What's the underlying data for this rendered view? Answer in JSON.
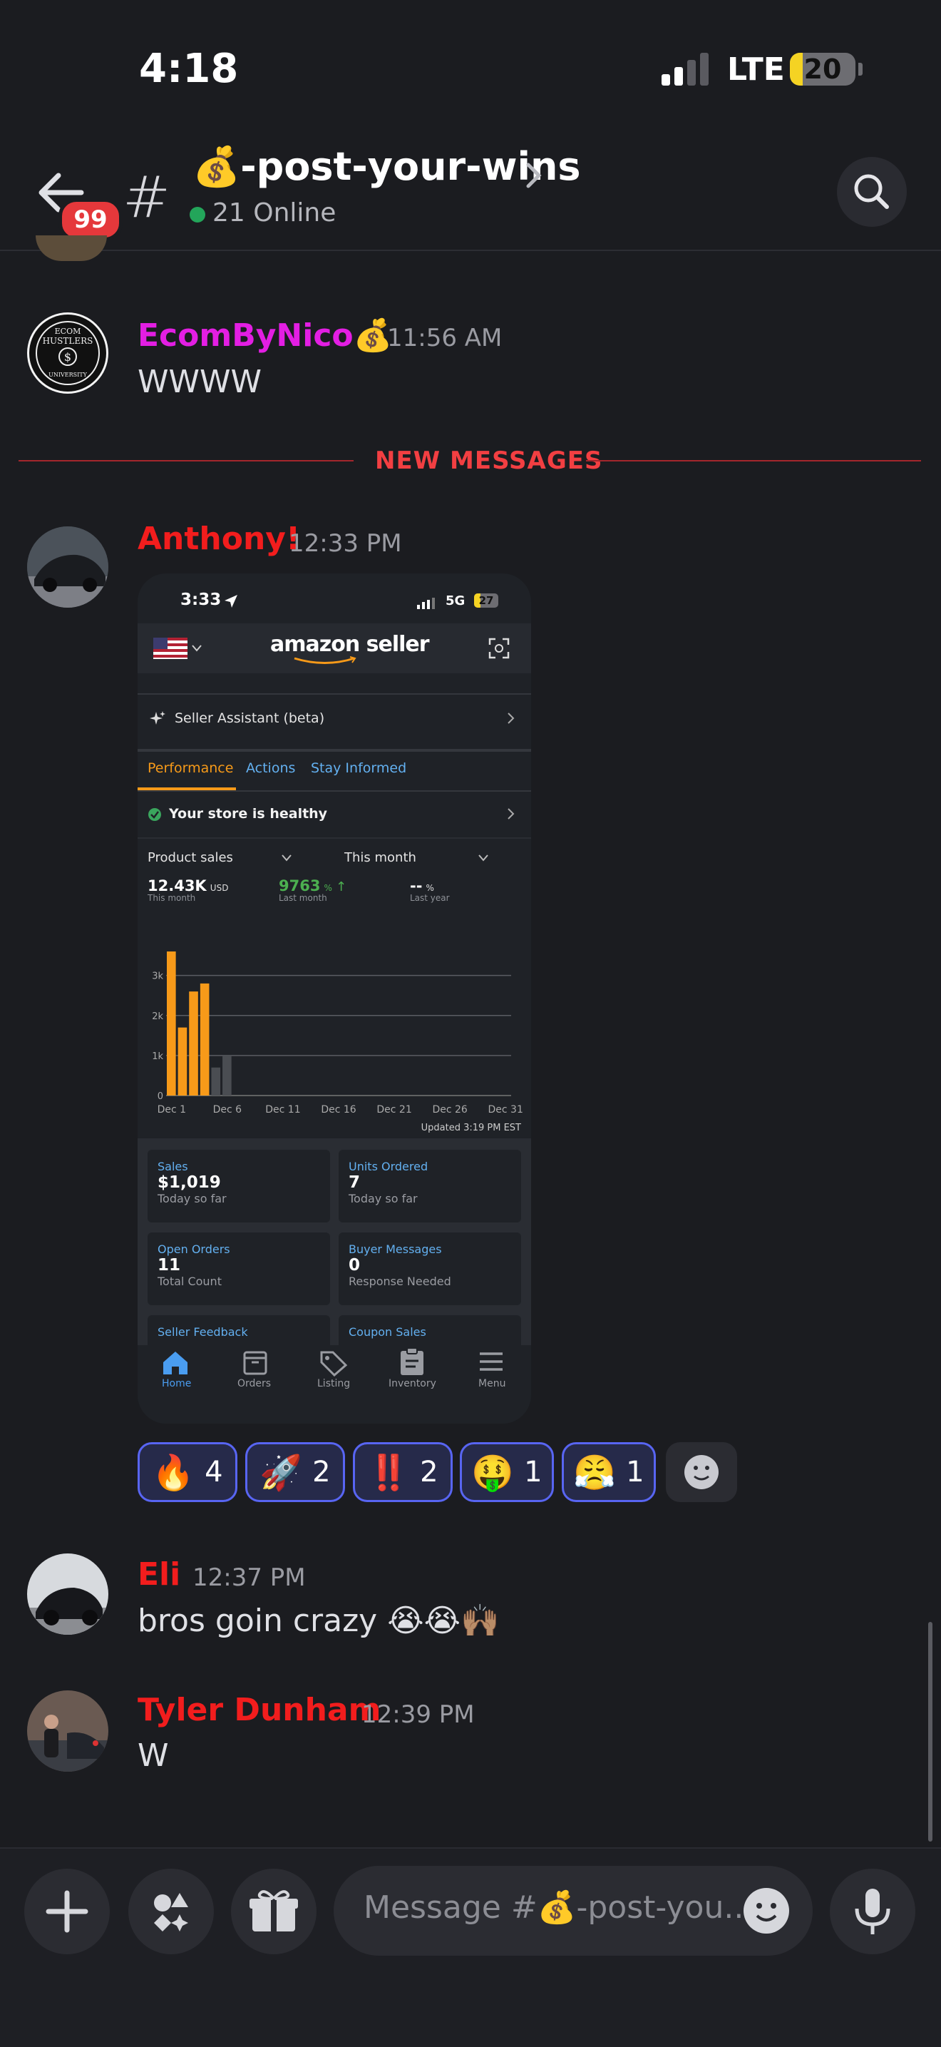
{
  "status": {
    "time": "4:18",
    "network": "LTE",
    "battery": "20",
    "battery_level": 0.2
  },
  "header": {
    "unread": "99",
    "hash": "#",
    "channel_emoji": "💰",
    "channel_name": "-post-your-wins",
    "online": "21 Online"
  },
  "messages": [
    {
      "user": "EcomByNico",
      "user_emoji": "💰",
      "time": "11:56 AM",
      "text": "WWWW",
      "color": "#e31ee3"
    },
    {
      "user": "Anthony!",
      "time": "12:33 PM",
      "color": "#f21d1d"
    },
    {
      "user": "Eli",
      "time": "12:37 PM",
      "text": "bros goin crazy 😭😭🙌🏽",
      "color": "#f21d1d"
    },
    {
      "user": "Tyler Dunham",
      "time": "12:39 PM",
      "text": "W",
      "color": "#f21d1d"
    }
  ],
  "new_messages_label": "NEW MESSAGES",
  "avatar_badge": {
    "top": "ECOM",
    "mid": "HUSTLERS",
    "bottom": "UNIVERSITY"
  },
  "attachment": {
    "time": "3:33",
    "network": "5G",
    "battery": "27",
    "battery_level": 0.27,
    "logo": "amazon seller",
    "assistant": "Seller Assistant (beta)",
    "tabs": [
      "Performance",
      "Actions",
      "Stay Informed"
    ],
    "health": "Your store is healthy",
    "metric_select": "Product sales",
    "period_select": "This month",
    "stats": [
      {
        "value": "12.43K",
        "unit": "USD",
        "label": "This month"
      },
      {
        "value": "9763",
        "unit": "%",
        "label": "Last month"
      },
      {
        "value": "--",
        "unit": "%",
        "label": "Last year"
      }
    ],
    "updated": "Updated 3:19 PM EST",
    "cards": [
      {
        "title": "Sales",
        "value": "$1,019",
        "sub": "Today so far"
      },
      {
        "title": "Units Ordered",
        "value": "7",
        "sub": "Today so far"
      },
      {
        "title": "Open Orders",
        "value": "11",
        "sub": "Total Count"
      },
      {
        "title": "Buyer Messages",
        "value": "0",
        "sub": "Response Needed"
      },
      {
        "title": "Seller Feedback",
        "value": "",
        "sub": ""
      },
      {
        "title": "Coupon Sales",
        "value": "",
        "sub": ""
      }
    ],
    "nav": [
      "Home",
      "Orders",
      "Listing",
      "Inventory",
      "Menu"
    ]
  },
  "chart_data": {
    "type": "bar",
    "categories": [
      "Dec 1",
      "Dec 2",
      "Dec 3",
      "Dec 4",
      "Dec 5",
      "Dec 6",
      "Dec 7"
    ],
    "series": [
      {
        "values": [
          3600,
          1700,
          2600,
          2800,
          0,
          0,
          0
        ],
        "color": "#f79a19"
      },
      {
        "values": [
          0,
          0,
          0,
          0,
          700,
          1000,
          0
        ],
        "color": "#4a4d52"
      }
    ],
    "x_ticks": [
      "Dec 1",
      "Dec 6",
      "Dec 11",
      "Dec 16",
      "Dec 21",
      "Dec 26",
      "Dec 31"
    ],
    "y_ticks": [
      "0",
      "1k",
      "2k",
      "3k"
    ],
    "ylim": [
      0,
      3600
    ],
    "grid": true
  },
  "reactions": [
    {
      "emoji": "🔥",
      "count": "4"
    },
    {
      "emoji": "🚀",
      "count": "2"
    },
    {
      "emoji": "‼️",
      "count": "2"
    },
    {
      "emoji": "🤑",
      "count": "1"
    },
    {
      "emoji": "😤",
      "count": "1"
    }
  ],
  "composer": {
    "placeholder": "Message #💰-post-you..."
  },
  "colors": {
    "accent": "#5865f2",
    "danger": "#f23f42",
    "online": "#23a55a",
    "amazon_orange": "#f79a19",
    "amazon_blue": "#63b0f0"
  }
}
